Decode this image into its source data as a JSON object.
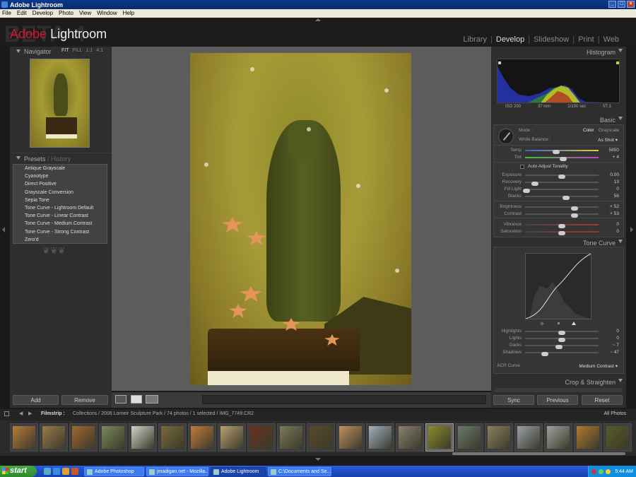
{
  "window": {
    "title": "Adobe Lightroom"
  },
  "menu": [
    "File",
    "Edit",
    "Develop",
    "Photo",
    "View",
    "Window",
    "Help"
  ],
  "header": {
    "beta": "BETA 4",
    "logo_adobe": "Adobe",
    "logo_name": "Lightroom"
  },
  "modules": [
    "Library",
    "Develop",
    "Slideshow",
    "Print",
    "Web"
  ],
  "active_module": "Develop",
  "navigator": {
    "title": "Navigator",
    "zoom": [
      "FIT",
      "FILL",
      "1:1",
      "4:1"
    ],
    "active_zoom": "FIT"
  },
  "presets": {
    "title": "Presets",
    "alt_tab": "History",
    "items": [
      "Antique Grayscale",
      "Cyanotype",
      "Direct Positive",
      "Grayscale Conversion",
      "Sepia Tone",
      "Tone Curve - Lightroom Default",
      "Tone Curve - Linear Contrast",
      "Tone Curve - Medium Contrast",
      "Tone Curve - Strong Contrast",
      "Zero'd"
    ]
  },
  "left_buttons": {
    "add": "Add",
    "remove": "Remove"
  },
  "histogram": {
    "title": "Histogram",
    "info": [
      "ISO 200",
      "37 mm",
      "1/100 sec",
      "f/7.1"
    ]
  },
  "basic": {
    "title": "Basic",
    "mode_label": "Mode :",
    "mode_color": "Color",
    "mode_grayscale": "Grayscale",
    "wb_label": "White Balance :",
    "wb_value": "As Shot",
    "auto_label": "Auto Adjust Tonality",
    "sliders": [
      {
        "label": "Temp",
        "value": "5850",
        "pos": 0.42,
        "group": 1
      },
      {
        "label": "Tint",
        "value": "+ 4",
        "pos": 0.52,
        "group": 1
      },
      {
        "label": "Exposure",
        "value": "0.00",
        "pos": 0.5,
        "group": 2
      },
      {
        "label": "Recovery",
        "value": "13",
        "pos": 0.13,
        "group": 2
      },
      {
        "label": "Fill Light",
        "value": "0",
        "pos": 0.02,
        "group": 2
      },
      {
        "label": "Blacks",
        "value": "56",
        "pos": 0.56,
        "group": 2
      },
      {
        "label": "Brightness",
        "value": "+ 52",
        "pos": 0.67,
        "group": 3
      },
      {
        "label": "Contrast",
        "value": "+ 53",
        "pos": 0.67,
        "group": 3
      },
      {
        "label": "Vibrance",
        "value": "0",
        "pos": 0.5,
        "group": 4
      },
      {
        "label": "Saturation",
        "value": "0",
        "pos": 0.5,
        "group": 4
      }
    ]
  },
  "tone_curve": {
    "title": "Tone Curve",
    "sliders": [
      {
        "label": "Highlights",
        "value": "0",
        "pos": 0.5
      },
      {
        "label": "Lights",
        "value": "0",
        "pos": 0.5
      },
      {
        "label": "Darks",
        "value": "~ 7",
        "pos": 0.46
      },
      {
        "label": "Shadows",
        "value": "~ 47",
        "pos": 0.27
      }
    ],
    "acr_label": "ACR Curve",
    "acr_value": "Medium Contrast"
  },
  "crop": {
    "title": "Crop & Straighten"
  },
  "right_buttons": {
    "sync": "Sync",
    "previous": "Previous",
    "reset": "Reset"
  },
  "filmstrip": {
    "label": "Filmstrip :",
    "path": "Collections / 2006 Lorneir Sculpture Park / 74 photos / 1 selected / IMG_7749.CR2",
    "filter": "All Photos",
    "thumb_colors": [
      "#b87a3a",
      "#9a7a4a",
      "#a06830",
      "#7a8a5a",
      "#d0d0c8",
      "#7a6a3a",
      "#c07a3a",
      "#b8a070",
      "#6a3020",
      "#7a7a5a",
      "#5a4a2a",
      "#c09060",
      "#a0b0c0",
      "#8a8070",
      "#8a8a2a",
      "#6a7a6a",
      "#8a8060",
      "#9aa0a8",
      "#a0a0a0",
      "#b07a30",
      "#5a5a2a"
    ],
    "selected_index": 14
  },
  "taskbar": {
    "start": "start",
    "tasks": [
      "Adobe Photoshop",
      "jmadigan.net - Mozilla...",
      "Adobe Lightroom",
      "C:\\Documents and Se..."
    ],
    "active_task": 2,
    "clock": "5:44 AM"
  }
}
